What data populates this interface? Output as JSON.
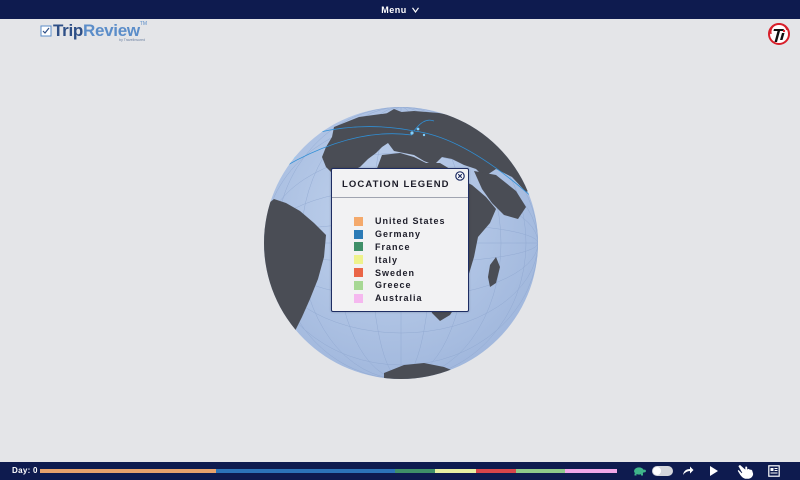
{
  "menu": {
    "label": "Menu"
  },
  "logo": {
    "trip": "Trip",
    "review": "Review",
    "tm": "TM",
    "subtitle": "by TravelInsured"
  },
  "legend": {
    "title": "LOCATION LEGEND",
    "items": [
      {
        "label": "United States",
        "color": "#f4a96b"
      },
      {
        "label": "Germany",
        "color": "#2c7bb6"
      },
      {
        "label": "France",
        "color": "#3f8f68"
      },
      {
        "label": "Italy",
        "color": "#eef28c"
      },
      {
        "label": "Sweden",
        "color": "#ea6547"
      },
      {
        "label": "Greece",
        "color": "#a7d894"
      },
      {
        "label": "Australia",
        "color": "#f5b8ef"
      }
    ]
  },
  "timeline": {
    "day_label": "Day: 0",
    "segments": [
      {
        "country": "United States",
        "fraction": 0.305,
        "color": "#e7a26c"
      },
      {
        "country": "Germany",
        "fraction": 0.31,
        "color": "#2c73b8"
      },
      {
        "country": "France",
        "fraction": 0.07,
        "color": "#3f8f68"
      },
      {
        "country": "Italy",
        "fraction": 0.07,
        "color": "#e8f0a3"
      },
      {
        "country": "Sweden",
        "fraction": 0.07,
        "color": "#d8464a"
      },
      {
        "country": "Greece",
        "fraction": 0.085,
        "color": "#8fc98a"
      },
      {
        "country": "Australia",
        "fraction": 0.09,
        "color": "#f0a8e8"
      }
    ]
  },
  "colors": {
    "bar": "#0e1b4f",
    "ocean": "#b4c8e6",
    "land": "#4a4d55",
    "route": "#2f8fd6"
  }
}
